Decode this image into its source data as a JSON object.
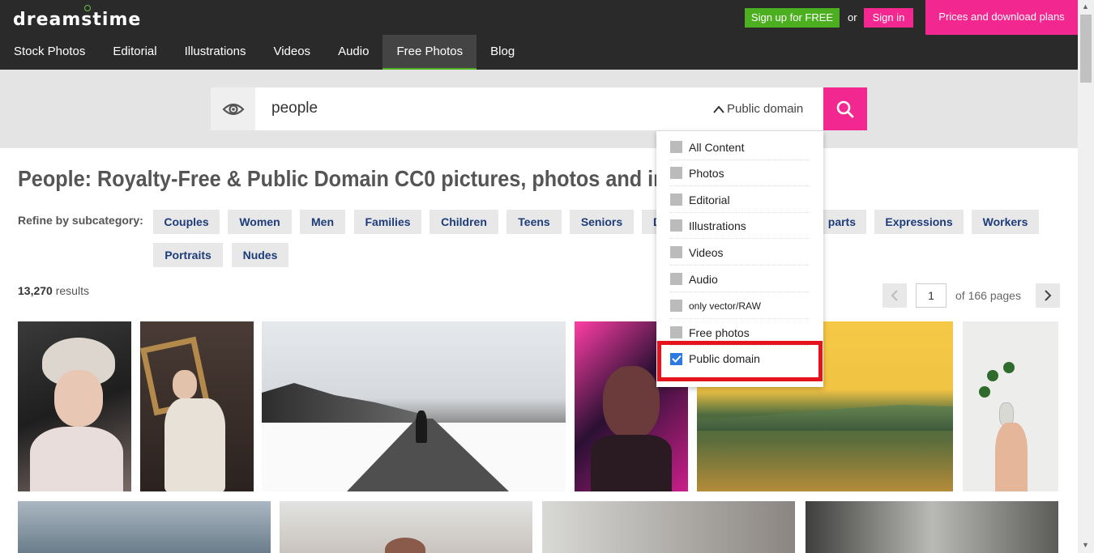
{
  "header": {
    "logo": "dreamstime",
    "signup_label": "Sign up for FREE",
    "or_label": "or",
    "signin_label": "Sign in",
    "prices_label": "Prices and download plans"
  },
  "nav": {
    "items": [
      "Stock Photos",
      "Editorial",
      "Illustrations",
      "Videos",
      "Audio",
      "Free Photos",
      "Blog"
    ],
    "active": "Free Photos"
  },
  "search": {
    "query": "people",
    "filter_selected": "Public domain"
  },
  "dropdown": {
    "options": [
      "All Content",
      "Photos",
      "Editorial",
      "Illustrations",
      "Videos",
      "Audio",
      "only vector/RAW",
      "Free photos",
      "Public domain"
    ],
    "checked": "Public domain"
  },
  "page": {
    "title": "People: Royalty-Free & Public Domain CC0 pictures, photos and images",
    "refine_label": "Refine by subcategory:",
    "subcategories": [
      "Couples",
      "Women",
      "Men",
      "Families",
      "Children",
      "Teens",
      "Seniors",
      "D",
      "parts",
      "Expressions",
      "Workers",
      "Portraits",
      "Nudes"
    ],
    "results_count": "13,270",
    "results_suffix": " results"
  },
  "pager": {
    "current_page": "1",
    "total_label": "of 166 pages"
  },
  "colors": {
    "accent_pink": "#f2278f",
    "accent_green": "#4caf1f",
    "header_bg": "#2a2a2a",
    "tag_text": "#1e3c7a",
    "highlight_red": "#e5141c"
  }
}
